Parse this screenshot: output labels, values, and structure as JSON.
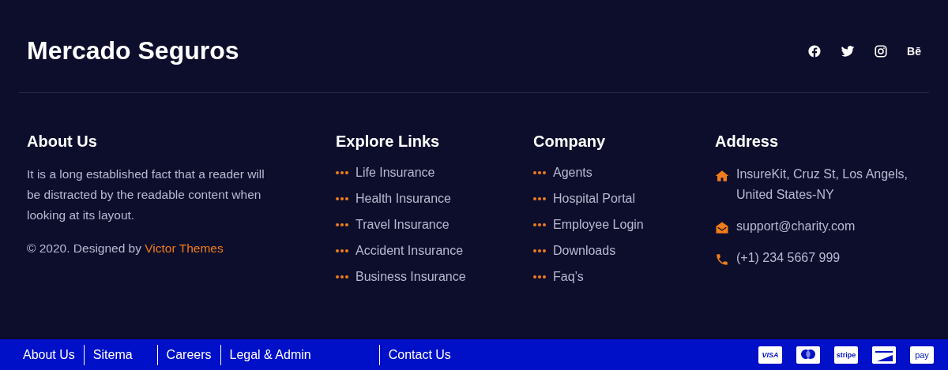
{
  "brand": "Mercado Seguros",
  "social": [
    {
      "kind": "facebook"
    },
    {
      "kind": "twitter"
    },
    {
      "kind": "instagram"
    },
    {
      "kind": "behance",
      "label": "Bē"
    }
  ],
  "about": {
    "heading": "About Us",
    "text": "It is a long established fact that a reader will be distracted by the readable content when looking at its layout.",
    "credit": "© 2020. Designed by",
    "credit_link": "Victor Themes"
  },
  "explore": {
    "heading": "Explore Links",
    "items": [
      "Life Insurance",
      "Health Insurance",
      "Travel Insurance",
      "Accident Insurance",
      "Business Insurance"
    ]
  },
  "company": {
    "heading": "Company",
    "items": [
      "Agents",
      "Hospital Portal",
      "Employee Login",
      "Downloads",
      "Faq’s"
    ]
  },
  "address": {
    "heading": "Address",
    "items": [
      {
        "kind": "home",
        "text": "InsureKit, Cruz St, Los Angels, United States-NY"
      },
      {
        "kind": "mail",
        "text": "support@charity.com"
      },
      {
        "kind": "phone",
        "text": "(+1) 234 5667 999"
      }
    ]
  },
  "bottom_links": [
    "About Us",
    "Sitema",
    "Careers",
    "Legal & Admin",
    "Contact Us"
  ],
  "payments": [
    {
      "kind": "visa",
      "label": "VISA"
    },
    {
      "kind": "mastercard"
    },
    {
      "kind": "stripe",
      "label": "stripe"
    },
    {
      "kind": "discover"
    },
    {
      "kind": "amazon",
      "label": "pay"
    }
  ]
}
